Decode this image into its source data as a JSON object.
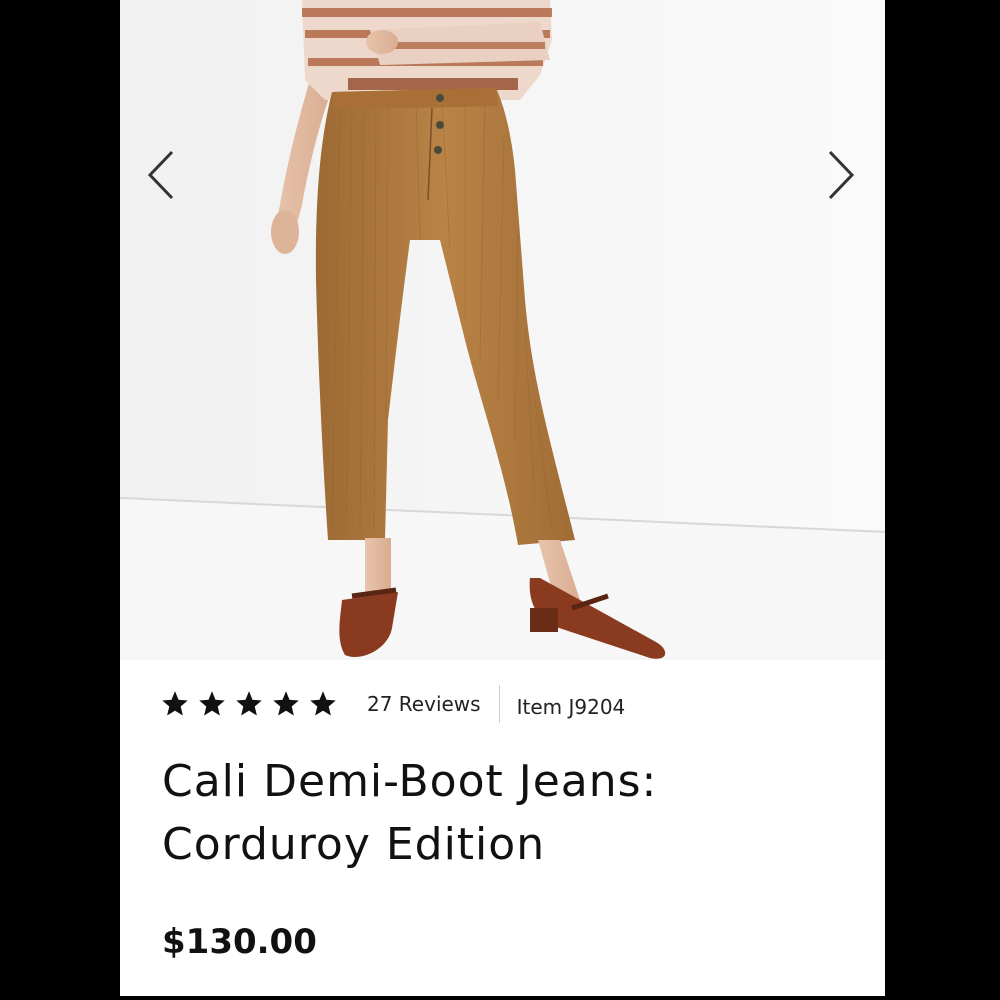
{
  "gallery": {
    "product_image_alt": "Cali Demi-Boot Jeans: Corduroy Edition",
    "prev_arrow_icon": "chevron-left-icon",
    "next_arrow_icon": "chevron-right-icon"
  },
  "product": {
    "rating": 5,
    "rating_max": 5,
    "star_icon": "star-icon",
    "reviews_label": "27 Reviews",
    "item_label": "Item J9204",
    "title_line1": "Cali Demi-Boot Jeans:",
    "title_line2": "Corduroy Edition",
    "price": "$130.00"
  },
  "colors": {
    "page_background": "#000000",
    "card_background": "#ffffff",
    "text": "#111111",
    "divider": "#cfcfcf",
    "corduroy": "#b07a3f",
    "shoe": "#8a3a1e"
  }
}
